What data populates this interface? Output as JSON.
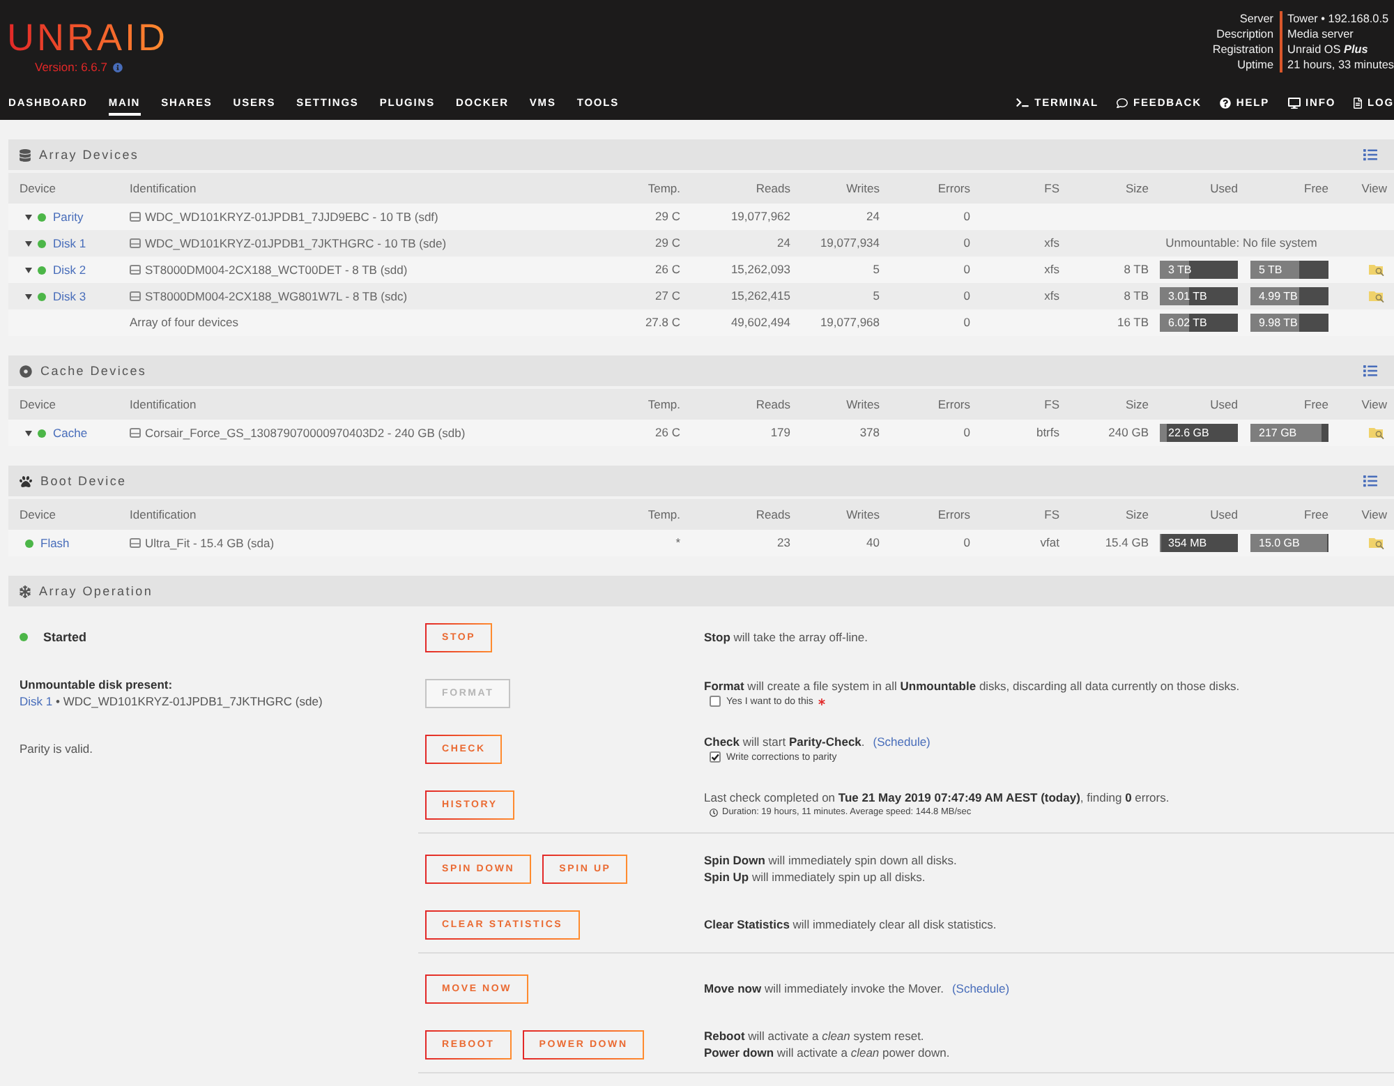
{
  "header": {
    "logo": "UNRAID",
    "version": "Version: 6.6.7",
    "server_info": [
      {
        "label": "Server",
        "value": "Tower • 192.168.0.5"
      },
      {
        "label": "Description",
        "value": "Media server"
      },
      {
        "label": "Registration",
        "value": "Unraid OS *Plus*"
      },
      {
        "label": "Uptime",
        "value": "21 hours, 33 minutes"
      }
    ],
    "nav": [
      {
        "label": "DASHBOARD",
        "selected": false
      },
      {
        "label": "MAIN",
        "selected": true
      },
      {
        "label": "SHARES",
        "selected": false
      },
      {
        "label": "USERS",
        "selected": false
      },
      {
        "label": "SETTINGS",
        "selected": false
      },
      {
        "label": "PLUGINS",
        "selected": false
      },
      {
        "label": "DOCKER",
        "selected": false
      },
      {
        "label": "VMS",
        "selected": false
      },
      {
        "label": "TOOLS",
        "selected": false
      }
    ],
    "nav_right": [
      {
        "kind": "terminal",
        "label": "TERMINAL"
      },
      {
        "kind": "feedback",
        "label": "FEEDBACK"
      },
      {
        "kind": "help",
        "label": "HELP"
      },
      {
        "kind": "info",
        "label": "INFO"
      },
      {
        "kind": "log",
        "label": "LOG"
      }
    ]
  },
  "device_sections": [
    {
      "kind": "array",
      "title": "Array Devices",
      "columns": [
        "Device",
        "Identification",
        "Temp.",
        "Reads",
        "Writes",
        "Errors",
        "FS",
        "Size",
        "Used",
        "Free",
        "View"
      ],
      "rows": [
        {
          "device": "Parity",
          "color": "#4cb648",
          "expandable": true,
          "identification": "WDC_WD101KRYZ-01JPDB1_7JJD9EBC - 10 TB (sdf)",
          "temp": "29 C",
          "reads": "19,077,962",
          "writes": "24",
          "errors": "0",
          "view": false
        },
        {
          "device": "Disk 1",
          "color": "#4cb648",
          "expandable": true,
          "identification": "WDC_WD101KRYZ-01JPDB1_7JKTHGRC - 10 TB (sde)",
          "temp": "29 C",
          "reads": "24",
          "writes": "19,077,934",
          "errors": "0",
          "fs": "xfs",
          "note": "Unmountable: No file system",
          "view": false
        },
        {
          "device": "Disk 2",
          "color": "#4cb648",
          "expandable": true,
          "identification": "ST8000DM004-2CX188_WCT00DET - 8 TB (sdd)",
          "temp": "26 C",
          "reads": "15,262,093",
          "writes": "5",
          "errors": "0",
          "fs": "xfs",
          "size": "8 TB",
          "used": {
            "text": "3 TB",
            "level": 0.375
          },
          "free": {
            "text": "5 TB",
            "level": 0.625
          },
          "view": true
        },
        {
          "device": "Disk 3",
          "color": "#4cb648",
          "expandable": true,
          "identification": "ST8000DM004-2CX188_WG801W7L - 8 TB (sdc)",
          "temp": "27 C",
          "reads": "15,262,415",
          "writes": "5",
          "errors": "0",
          "fs": "xfs",
          "size": "8 TB",
          "used": {
            "text": "3.01 TB",
            "level": 0.376
          },
          "free": {
            "text": "4.99 TB",
            "level": 0.624
          },
          "view": true
        }
      ],
      "total": {
        "identification": "Array of four devices",
        "temp": "27.8 C",
        "reads": "49,602,494",
        "writes": "19,077,968",
        "errors": "0",
        "size": "16 TB",
        "used": {
          "text": "6.02 TB",
          "level": 0.376
        },
        "free": {
          "text": "9.98 TB",
          "level": 0.624
        }
      }
    },
    {
      "kind": "cache",
      "title": "Cache Devices",
      "columns": [
        "Device",
        "Identification",
        "Temp.",
        "Reads",
        "Writes",
        "Errors",
        "FS",
        "Size",
        "Used",
        "Free",
        "View"
      ],
      "rows": [
        {
          "device": "Cache",
          "color": "#4cb648",
          "expandable": true,
          "identification": "Corsair_Force_GS_130879070000970403D2 - 240 GB (sdb)",
          "temp": "26 C",
          "reads": "179",
          "writes": "378",
          "errors": "0",
          "fs": "btrfs",
          "size": "240 GB",
          "used": {
            "text": "22.6 GB",
            "level": 0.094
          },
          "free": {
            "text": "217 GB",
            "level": 0.904
          },
          "view": true
        }
      ]
    },
    {
      "kind": "boot",
      "title": "Boot Device",
      "columns": [
        "Device",
        "Identification",
        "Temp.",
        "Reads",
        "Writes",
        "Errors",
        "FS",
        "Size",
        "Used",
        "Free",
        "View"
      ],
      "rows": [
        {
          "device": "Flash",
          "color": "#4cb648",
          "expandable": false,
          "identification": "Ultra_Fit - 15.4 GB (sda)",
          "temp": "*",
          "reads": "23",
          "writes": "40",
          "errors": "0",
          "fs": "vfat",
          "size": "15.4 GB",
          "used": {
            "text": "354 MB",
            "level": 0.023
          },
          "free": {
            "text": "15.0 GB",
            "level": 0.974
          },
          "view": true
        }
      ]
    }
  ],
  "array_operation": {
    "title": "Array Operation",
    "groups": [
      {
        "rows": [
          {
            "left": {
              "kind": "status",
              "label": "Started",
              "color": "#4cb648"
            },
            "buttons": [
              {
                "label": "STOP",
                "disabled": false
              }
            ],
            "description": [
              {
                "text": "**Stop** will take the array off-line."
              }
            ]
          },
          {
            "left": {
              "kind": "warning",
              "title": "Unmountable disk present:",
              "link": "Disk 1",
              "detail": "• WDC_WD101KRYZ-01JPDB1_7JKTHGRC (sde)"
            },
            "buttons": [
              {
                "label": "FORMAT",
                "disabled": true
              }
            ],
            "description": [
              {
                "text": "**Format** will create a file system in all **Unmountable** disks, discarding all data currently on those disks."
              }
            ],
            "option": {
              "label": "Yes I want to do this",
              "checked": false,
              "required": true
            }
          },
          {
            "left": {
              "kind": "text",
              "text": "Parity is valid."
            },
            "buttons": [
              {
                "label": "CHECK",
                "disabled": false
              }
            ],
            "description": [
              {
                "text": "**Check** will start **Parity-Check**.",
                "link": "(Schedule)"
              }
            ],
            "option": {
              "label": "Write corrections to parity",
              "checked": true
            }
          },
          {
            "buttons": [
              {
                "label": "HISTORY",
                "disabled": false
              }
            ],
            "description": [
              {
                "text": "Last check completed on **Tue 21 May 2019 07:47:49 AM AEST (today)**, finding **0** errors."
              }
            ],
            "note": "Duration: 19 hours, 11 minutes. Average speed: 144.8 MB/sec"
          }
        ]
      },
      {
        "rows": [
          {
            "buttons": [
              {
                "label": "SPIN DOWN",
                "disabled": false
              },
              {
                "label": "SPIN UP",
                "disabled": false
              }
            ],
            "description": [
              {
                "text": "**Spin Down** will immediately spin down all disks."
              },
              {
                "text": "**Spin Up** will immediately spin up all disks."
              }
            ]
          },
          {
            "buttons": [
              {
                "label": "CLEAR STATISTICS",
                "disabled": false
              }
            ],
            "description": [
              {
                "text": "**Clear Statistics** will immediately clear all disk statistics."
              }
            ]
          }
        ]
      },
      {
        "rows": [
          {
            "buttons": [
              {
                "label": "MOVE NOW",
                "disabled": false
              }
            ],
            "description": [
              {
                "text": "**Move now** will immediately invoke the Mover.",
                "link": "(Schedule)"
              }
            ]
          },
          {
            "buttons": [
              {
                "label": "REBOOT",
                "disabled": false
              },
              {
                "label": "POWER DOWN",
                "disabled": false
              }
            ],
            "description": [
              {
                "text": "**Reboot** will activate a *clean* system reset."
              },
              {
                "text": "**Power down** will activate a *clean* power down."
              }
            ]
          }
        ]
      }
    ]
  }
}
